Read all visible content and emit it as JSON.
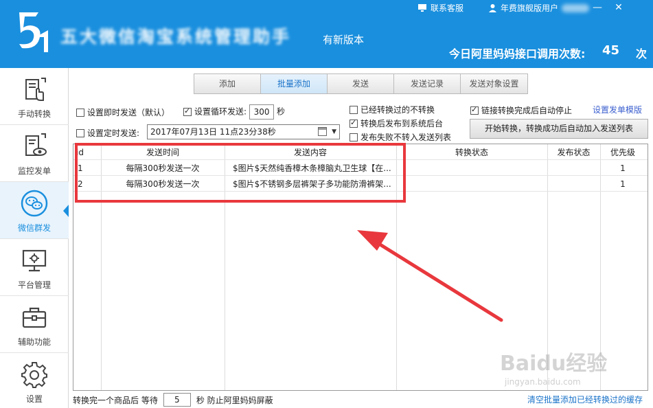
{
  "header": {
    "app_title": "五大微信淘宝系统管理助手",
    "new_version": "有新版本",
    "customer_service": "联系客服",
    "user_label": "年费旗舰版用户",
    "minimize": "—",
    "close": "✕",
    "api_label": "今日阿里妈妈接口调用次数:",
    "api_count": "45",
    "api_unit": "次",
    "brand_color": "#1a8fde"
  },
  "sidebar": {
    "items": [
      {
        "label": "手动转换",
        "icon": "manual-convert-icon"
      },
      {
        "label": "监控发单",
        "icon": "monitor-icon"
      },
      {
        "label": "微信群发",
        "icon": "wechat-icon"
      },
      {
        "label": "平台管理",
        "icon": "platform-icon"
      },
      {
        "label": "辅助功能",
        "icon": "toolbox-icon"
      },
      {
        "label": "设置",
        "icon": "gear-icon"
      }
    ],
    "active_index": 2
  },
  "tabs": [
    "添加",
    "批量添加",
    "发送",
    "发送记录",
    "发送对象设置"
  ],
  "active_tab": 1,
  "settings": {
    "instant_send": "设置即时发送（默认）",
    "loop_send": "设置循环发送:",
    "loop_interval": "300",
    "seconds": "秒",
    "timed_send": "设置定时发送:",
    "datetime": "2017年07月13日  11点23分38秒",
    "skip_converted": "已经转换过的不转换",
    "publish_backend": "转换后发布到系统后台",
    "fail_no_list": "发布失败不转入发送列表",
    "auto_stop": "链接转换完成后自动停止",
    "template_link": "设置发单模版",
    "start_button": "开始转换，转换成功后自动加入发送列表"
  },
  "table": {
    "columns": [
      "id",
      "发送时间",
      "发送内容",
      "转换状态",
      "发布状态",
      "优先级"
    ],
    "rows": [
      [
        "1",
        "每隔300秒发送一次",
        "$图片$天然纯香樟木条樟脑丸卫生球【在...",
        "",
        "",
        "1"
      ],
      [
        "2",
        "每隔300秒发送一次",
        "$图片$不锈钢多层裤架子多功能防滑裤架...",
        "",
        "",
        "1"
      ]
    ]
  },
  "footer": {
    "prefix": "转换完一个商品后 等待",
    "wait_value": "5",
    "suffix": "秒 防止阿里妈妈屏蔽",
    "clear_link": "清空批量添加已经转换过的缓存"
  },
  "watermark": {
    "main": "Baidu经验",
    "sub": "jingyan.baidu.com"
  }
}
